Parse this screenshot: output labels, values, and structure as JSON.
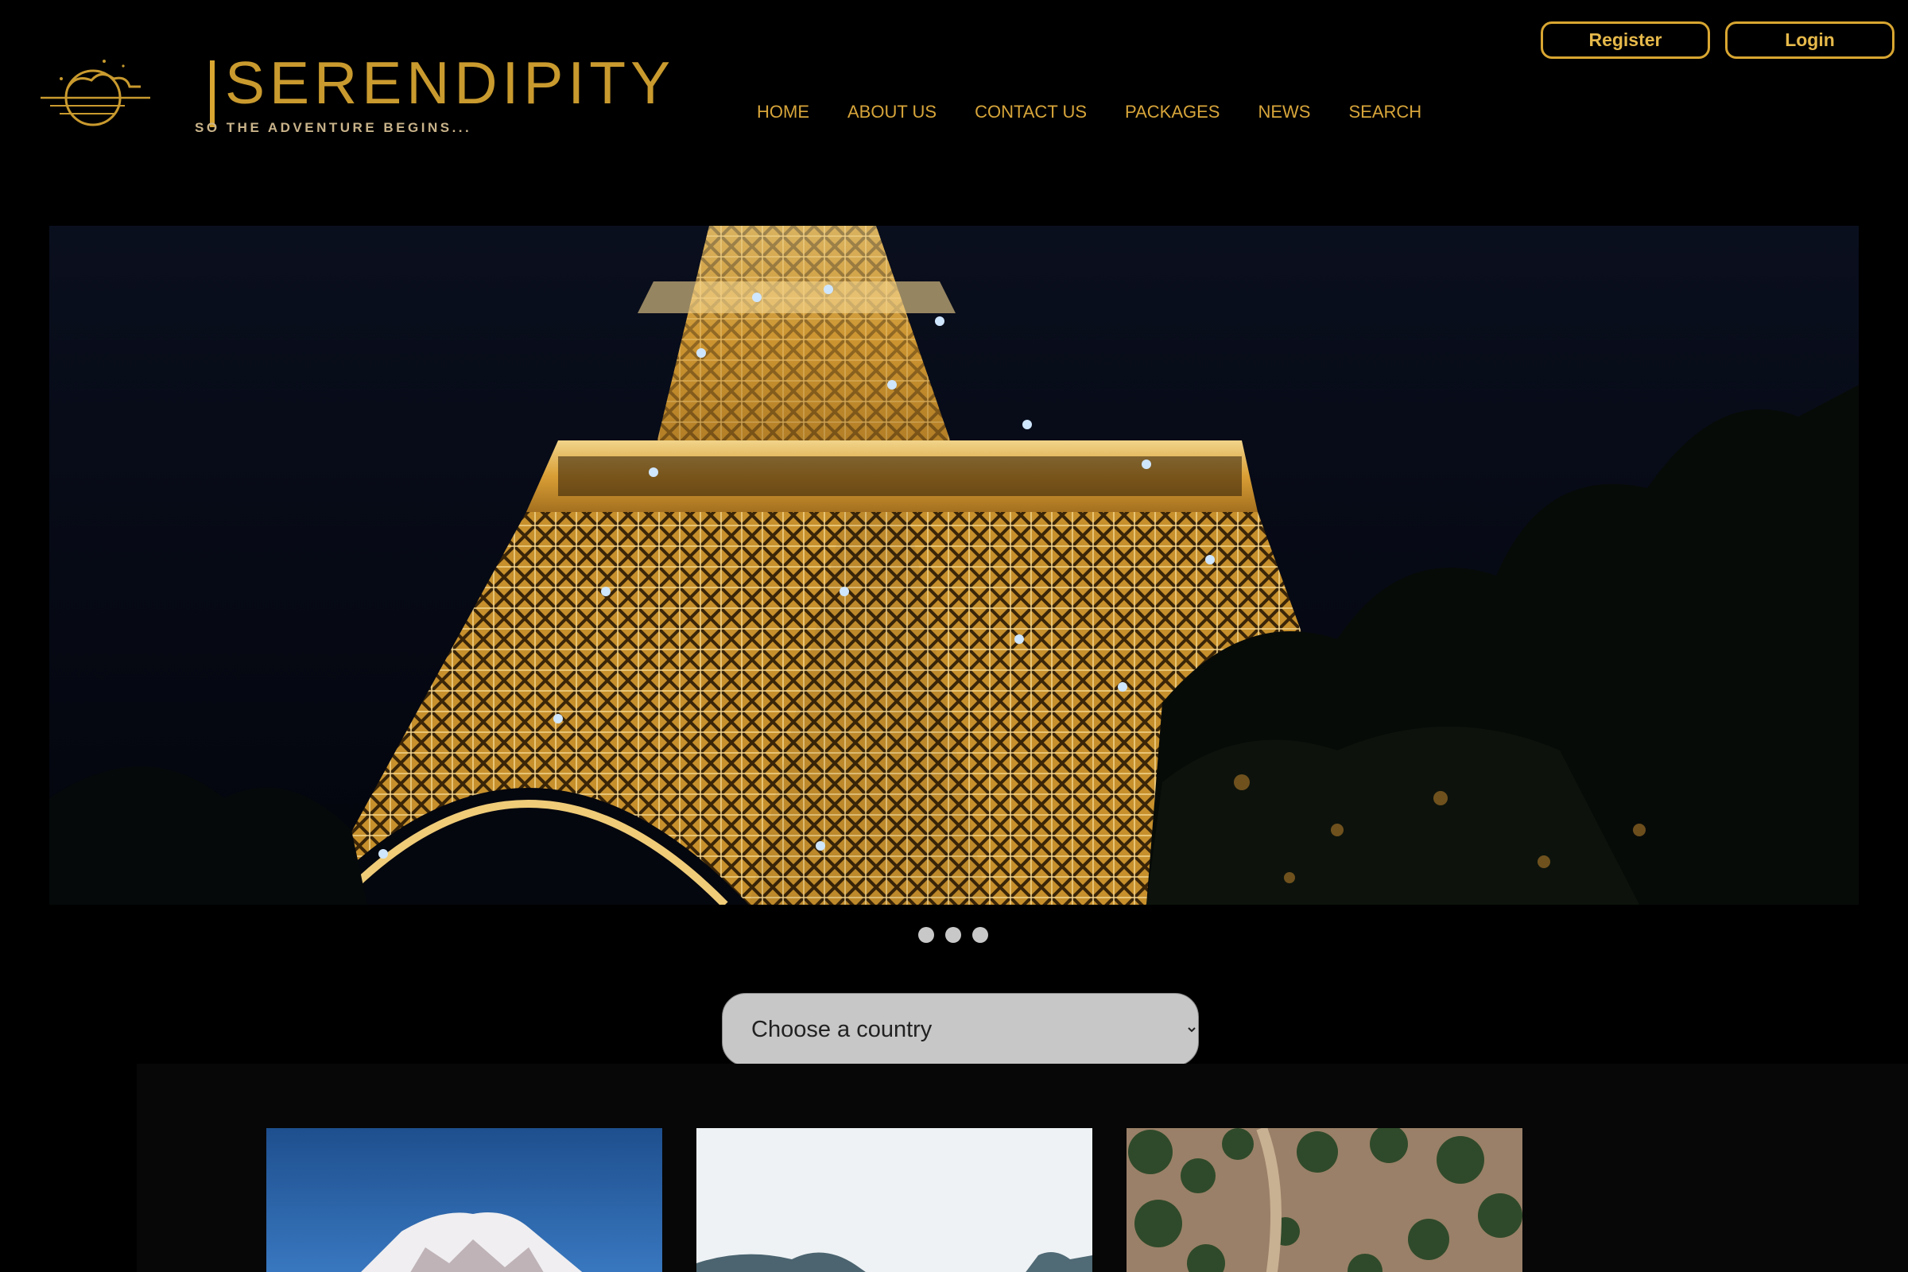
{
  "header": {
    "logo": {
      "name": "SERENDIPITY",
      "tagline": "SO THE ADVENTURE BEGINS..."
    },
    "auth": {
      "register_label": "Register",
      "login_label": "Login"
    },
    "nav": {
      "home": "HOME",
      "about": "ABOUT US",
      "contact": "CONTACT US",
      "packages": "PACKAGES",
      "news": "NEWS",
      "search": "SEARCH"
    }
  },
  "carousel": {
    "slide_count": 3,
    "active_index": 0
  },
  "filter": {
    "selected": "Choose a country"
  },
  "colors": {
    "accent": "#d8a631",
    "background": "#000000",
    "select_bg": "#c7c7c7"
  }
}
